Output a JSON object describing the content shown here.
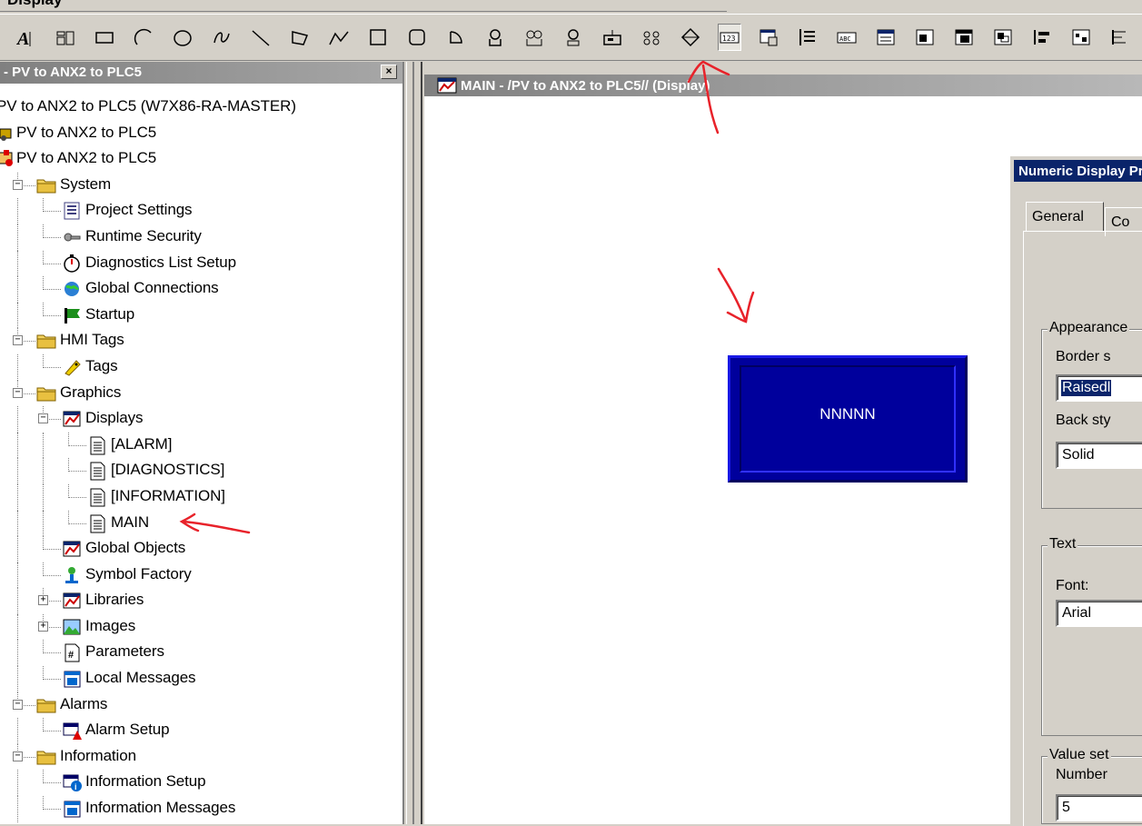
{
  "menu": {
    "cut_label": "Display"
  },
  "toolbar": {
    "icons": [
      "text-tool-icon",
      "wizard-icon",
      "rectangle-icon",
      "arc-icon",
      "ellipse-icon",
      "freehand-icon",
      "line-icon",
      "polygon-icon",
      "polyline-icon",
      "square-icon",
      "rounded-rect-icon",
      "wedge-icon",
      "button-icon",
      "multistate-button-icon",
      "indicator-icon",
      "display-button-icon",
      "goto-button-icon",
      "updown-icon",
      "numeric-display-icon",
      "list-icon",
      "bar-graph-icon",
      "string-display-icon",
      "message-display-icon",
      "alarm-banner-icon",
      "alarm-list-icon",
      "trend-icon",
      "gauge-icon",
      "panel-icon",
      "scale-icon"
    ]
  },
  "left_pane": {
    "title": "- PV to ANX2 to PLC5",
    "close_label": "×",
    "tree": [
      {
        "label": "PV to ANX2 to PLC5 (W7X86-RA-MASTER)",
        "level": 0,
        "icon": "none"
      },
      {
        "label": "PV to ANX2 to PLC5",
        "level": 0,
        "icon": "application-icon"
      },
      {
        "label": "PV to ANX2 to PLC5",
        "level": 0,
        "icon": "area-icon"
      },
      {
        "label": "System",
        "level": 1,
        "icon": "folder-icon",
        "expander": "minus"
      },
      {
        "label": "Project Settings",
        "level": 2,
        "icon": "settings-icon"
      },
      {
        "label": "Runtime Security",
        "level": 2,
        "icon": "key-icon"
      },
      {
        "label": "Diagnostics List Setup",
        "level": 2,
        "icon": "stopwatch-icon"
      },
      {
        "label": "Global Connections",
        "level": 2,
        "icon": "globe-icon"
      },
      {
        "label": "Startup",
        "level": 2,
        "icon": "flag-icon"
      },
      {
        "label": "HMI Tags",
        "level": 1,
        "icon": "folder-icon",
        "expander": "minus"
      },
      {
        "label": "Tags",
        "level": 2,
        "icon": "tag-icon"
      },
      {
        "label": "Graphics",
        "level": 1,
        "icon": "folder-icon",
        "expander": "minus"
      },
      {
        "label": "Displays",
        "level": 2,
        "icon": "displays-icon",
        "expander": "minus"
      },
      {
        "label": "[ALARM]",
        "level": 3,
        "icon": "page-icon"
      },
      {
        "label": "[DIAGNOSTICS]",
        "level": 3,
        "icon": "page-icon"
      },
      {
        "label": "[INFORMATION]",
        "level": 3,
        "icon": "page-icon"
      },
      {
        "label": "MAIN",
        "level": 3,
        "icon": "page-icon"
      },
      {
        "label": "Global Objects",
        "level": 2,
        "icon": "displays-icon"
      },
      {
        "label": "Symbol Factory",
        "level": 2,
        "icon": "symbol-factory-icon"
      },
      {
        "label": "Libraries",
        "level": 2,
        "icon": "displays-icon",
        "expander": "plus"
      },
      {
        "label": "Images",
        "level": 2,
        "icon": "images-icon",
        "expander": "plus"
      },
      {
        "label": "Parameters",
        "level": 2,
        "icon": "parameters-icon"
      },
      {
        "label": "Local Messages",
        "level": 2,
        "icon": "messages-icon"
      },
      {
        "label": "Alarms",
        "level": 1,
        "icon": "folder-icon",
        "expander": "minus"
      },
      {
        "label": "Alarm Setup",
        "level": 2,
        "icon": "alarm-setup-icon"
      },
      {
        "label": "Information",
        "level": 1,
        "icon": "folder-icon",
        "expander": "minus"
      },
      {
        "label": "Information Setup",
        "level": 2,
        "icon": "info-setup-icon"
      },
      {
        "label": "Information Messages",
        "level": 2,
        "icon": "messages-icon"
      }
    ]
  },
  "display": {
    "title": "MAIN - /PV to ANX2 to PLC5// (Display)",
    "numeric_value": "NNNNN"
  },
  "dialog": {
    "title": "Numeric Display Properties",
    "tabs": [
      "General",
      "Co"
    ],
    "appearance_group": "Appearance",
    "border_style_label": "Border s",
    "border_style_value": "Raisedl",
    "back_style_label": "Back sty",
    "back_style_value": "Solid",
    "text_group": "Text",
    "font_label": "Font:",
    "font_value": "Arial",
    "value_group": "Value set",
    "number_label": "Number",
    "number_value": "5"
  },
  "colors": {
    "face": "#d4d0c8",
    "numeric_bg": "#00009c",
    "dialog_title": "#0a246a",
    "annotation": "#e8222a"
  }
}
